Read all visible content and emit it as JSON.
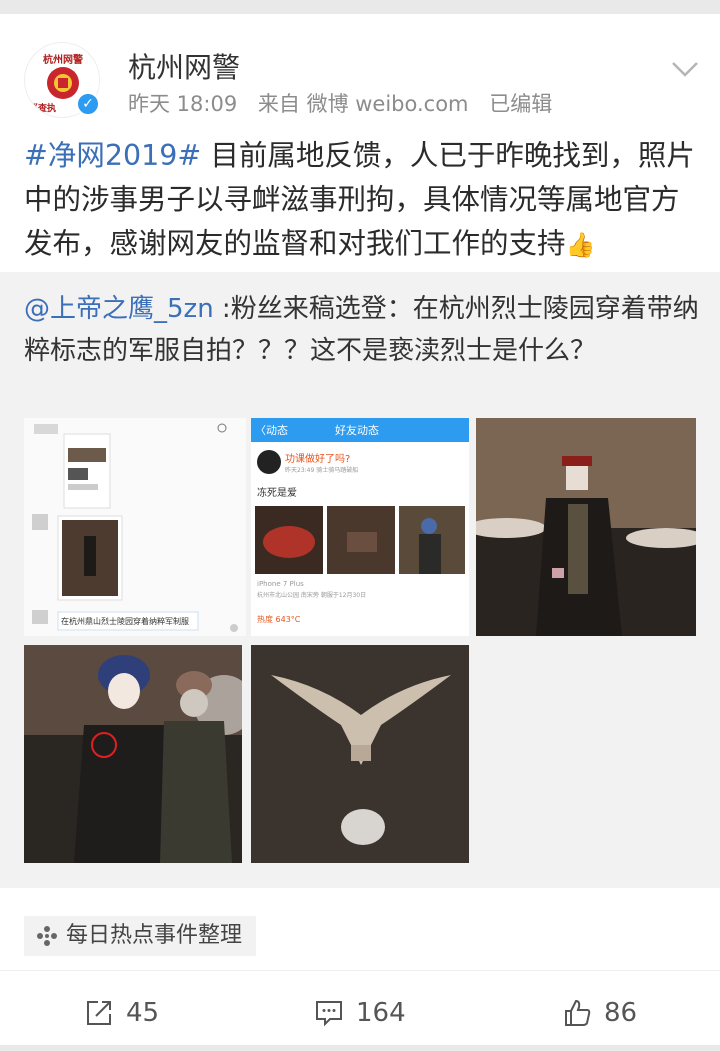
{
  "account": {
    "name": "杭州网警",
    "avatar_text_top": "杭州网警",
    "avatar_text_bottom": "巡查执",
    "time": "昨天 18:09",
    "source": "来自 微博 weibo.com",
    "edited": "已编辑"
  },
  "post": {
    "hashtag": "#净网2019#",
    "text": " 目前属地反馈，人已于昨晚找到，照片中的涉事男子以寻衅滋事刑拘，具体情况等属地官方发布，感谢网友的监督和对我们工作的支持",
    "emoji": "👍"
  },
  "repost": {
    "mention": "@上帝之鹰_5zn",
    "text": " :粉丝来稿选登：在杭州烈士陵园穿着带纳粹标志的军服自拍？？？这不是亵渎烈士是什么？",
    "images": {
      "screenshot2": {
        "back_label": "〈动态",
        "title": "好友动态",
        "post_user": "功课做好了吗?",
        "post_time": "昨天23:49 骑士骑马踏破船",
        "post_caption": "冻死是爱",
        "device": "iPhone 7 Plus",
        "location": "杭州市北山公园 南宋旁 朝服于12月30日",
        "heat": "热度 643°C"
      },
      "screenshot1": {
        "caption": "在杭州鼎山烈士陵园穿着纳粹军制服"
      }
    }
  },
  "tag_chip": {
    "label": "每日热点事件整理"
  },
  "actions": {
    "share_count": "45",
    "comment_count": "164",
    "like_count": "86"
  },
  "colors": {
    "link": "#3b6fb8",
    "verified": "#2c9bf0",
    "meta": "#8c8c8c",
    "repost_bg": "#f2f2f2"
  }
}
